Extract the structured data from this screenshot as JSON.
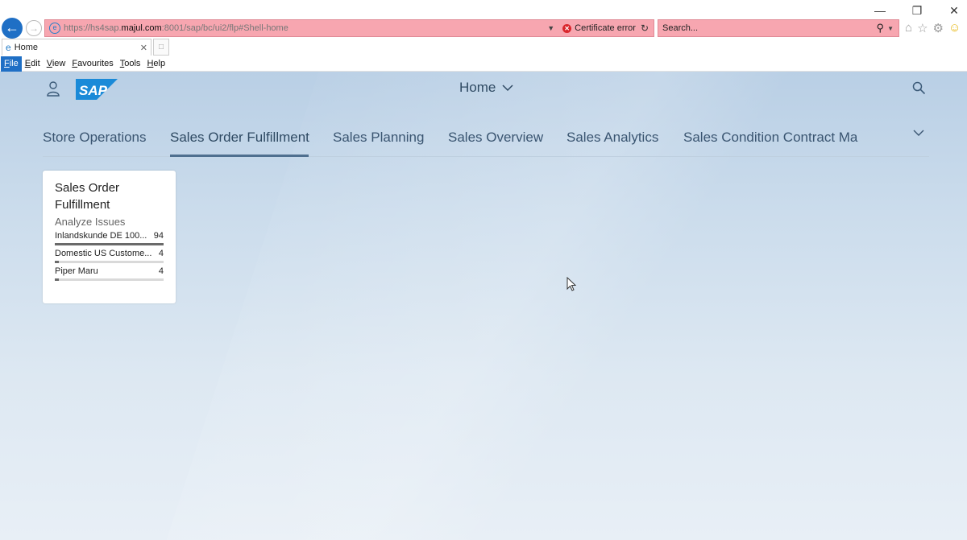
{
  "browser": {
    "window_controls": {
      "minimize": "—",
      "restore": "❐",
      "close": "✕"
    },
    "address": {
      "url_prefix": "https://hs4sap.",
      "url_host": "majul.com",
      "url_rest": ":8001/sap/bc/ui2/flp#Shell-home",
      "cert_error_label": "Certificate error"
    },
    "search": {
      "placeholder": "Search..."
    },
    "tab": {
      "label": "Home"
    },
    "menu": [
      "File",
      "Edit",
      "View",
      "Favourites",
      "Tools",
      "Help"
    ],
    "colors": {
      "address_bar_error": "#f7a6b0",
      "accent": "#1f6fc5"
    }
  },
  "shell": {
    "title": "Home",
    "logo_text": "SAP",
    "tabs": [
      {
        "label": "Store Operations"
      },
      {
        "label": "Sales Order Fulfillment",
        "selected": true
      },
      {
        "label": "Sales Planning"
      },
      {
        "label": "Sales Overview"
      },
      {
        "label": "Sales Analytics"
      },
      {
        "label": "Sales Condition Contract Ma"
      }
    ]
  },
  "tile": {
    "title_line1": "Sales Order",
    "title_line2": "Fulfillment",
    "subtitle": "Analyze Issues",
    "rows": [
      {
        "name": "Inlandskunde DE 100...",
        "value": "94",
        "fill": 1.0
      },
      {
        "name": "Domestic US Custome...",
        "value": "4",
        "fill": 0.04
      },
      {
        "name": "Piper Maru",
        "value": "4",
        "fill": 0.04
      }
    ]
  }
}
